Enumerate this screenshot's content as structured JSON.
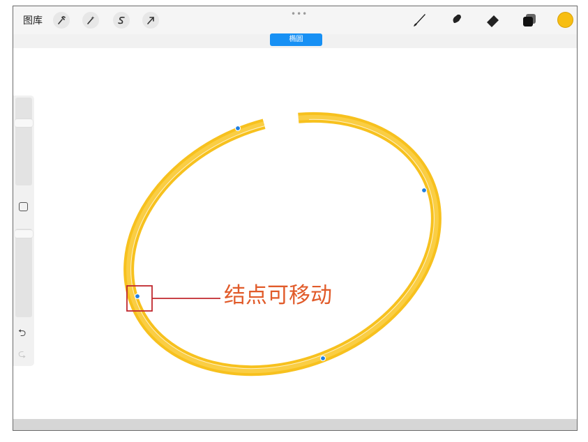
{
  "toolbar": {
    "gallery_label": "图库",
    "left_tools": [
      "wrench-icon",
      "magic-wand-icon",
      "selection-icon",
      "transform-arrow-icon"
    ],
    "more_dots": "•••",
    "right_tools": [
      "brush-icon",
      "smudge-icon",
      "eraser-icon",
      "layers-icon"
    ],
    "color": "#f7be12"
  },
  "shape_badge": {
    "label": "椭圆"
  },
  "sidebar": {
    "undo_symbol": "⮌",
    "redo_symbol": "⮎"
  },
  "canvas": {
    "stroke_color": "#f7be12",
    "node_color": "#1f7fe0"
  },
  "annotation": {
    "text": "结点可移动",
    "color": "#e15b2a",
    "box_color": "#c0272d"
  }
}
